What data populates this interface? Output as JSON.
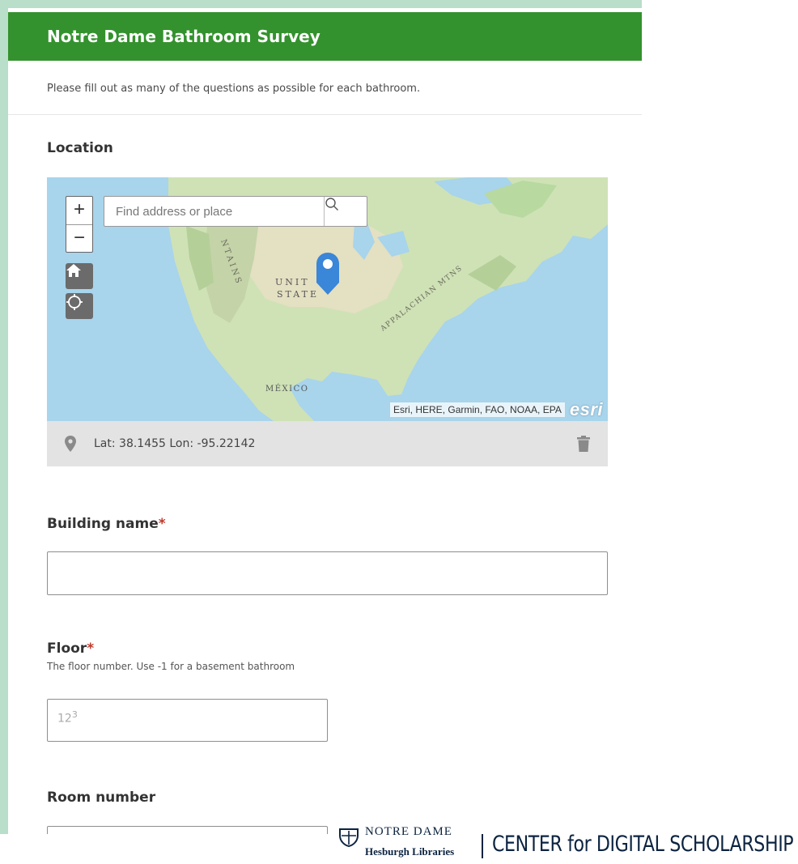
{
  "survey": {
    "title": "Notre Dame Bathroom Survey",
    "description": "Please fill out as many of the questions as possible for each bathroom."
  },
  "location": {
    "label": "Location",
    "map": {
      "search_placeholder": "Find address or place",
      "zoom_in": "+",
      "zoom_out": "−",
      "labels": {
        "united": "UNIT",
        "states": "STATE",
        "mexico": "MÉXICO",
        "appalachian": "APPALACHIAN MTNS",
        "mountains": "NTAINS"
      },
      "attribution": "Esri, HERE, Garmin, FAO, NOAA, EPA",
      "logo": "esri",
      "icons": [
        "zoom-in-icon",
        "zoom-out-icon",
        "home-icon",
        "locate-icon",
        "search-icon",
        "map-pin-icon"
      ]
    },
    "coordinates": "Lat: 38.1455 Lon: -95.22142",
    "icons": [
      "location-marker-icon",
      "trash-icon"
    ]
  },
  "building_name": {
    "label": "Building name",
    "required_mark": "*",
    "value": ""
  },
  "floor": {
    "label": "Floor",
    "required_mark": "*",
    "hint": "The floor number. Use -1 for a basement bathroom",
    "placeholder_base": "12",
    "placeholder_sup": "3"
  },
  "room_number": {
    "label": "Room number"
  },
  "footer": {
    "notre_dame": "NOTRE DAME",
    "hesburgh": "Hesburgh Libraries",
    "center": "CENTER for DIGITAL SCHOLARSHIP"
  },
  "colors": {
    "header_green": "#33922d",
    "frame": "#b9dec9",
    "map_pin": "#3a86d8",
    "required": "#c0392b",
    "footer_navy": "#0c2340"
  }
}
